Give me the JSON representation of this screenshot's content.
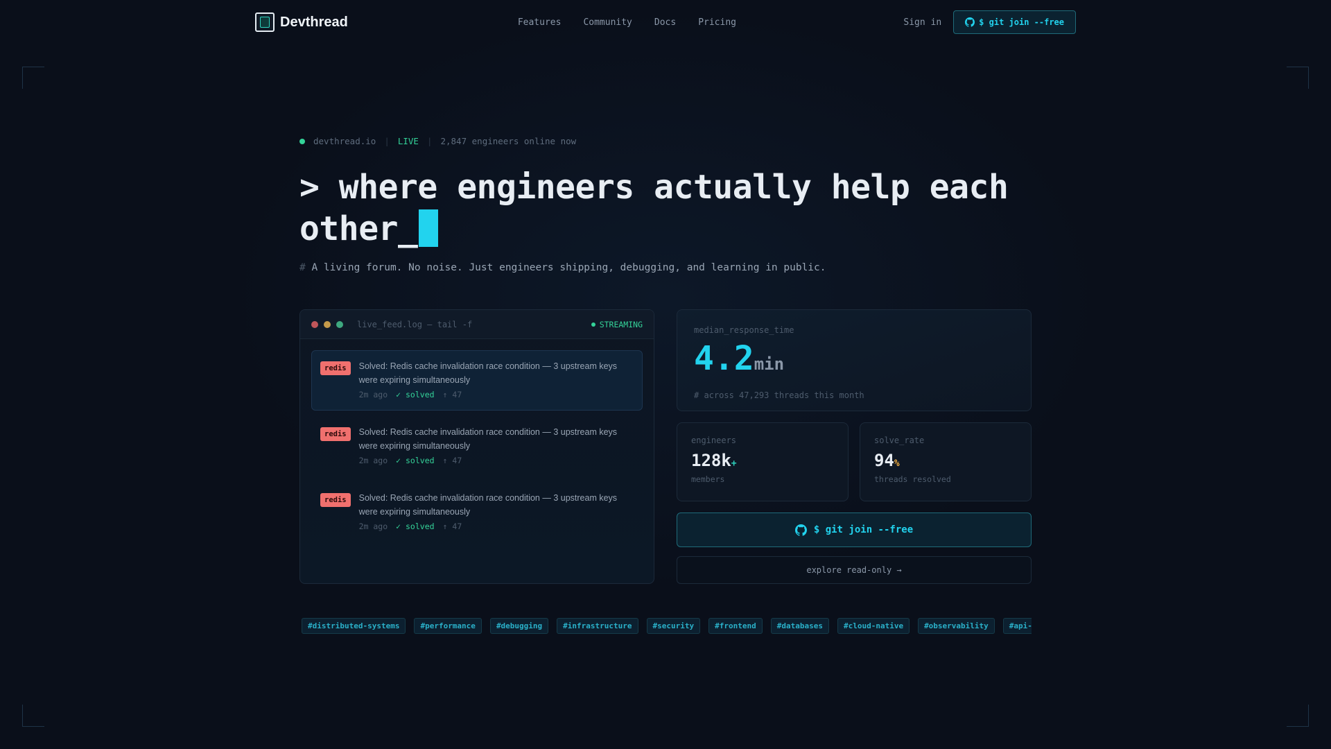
{
  "nav": {
    "brand": "Devthread",
    "links": [
      "Features",
      "Community",
      "Docs",
      "Pricing"
    ],
    "signin": "Sign in",
    "cta": "$ git join --free"
  },
  "hero": {
    "domain": "devthread.io",
    "live": "LIVE",
    "online": "2,847 engineers online now",
    "headline": "> where engineers actually help each other_",
    "sub_hash": "#",
    "subline": "A living forum. No noise. Just engineers shipping, debugging, and learning in public."
  },
  "terminal": {
    "title": "live_feed.log — tail -f",
    "status": "STREAMING",
    "items": [
      {
        "tag": "redis",
        "title": "Solved: Redis cache invalidation race condition — 3 upstream keys were expiring simultaneously",
        "time": "2m ago",
        "solved": "✓ solved",
        "votes": "↑ 47"
      },
      {
        "tag": "redis",
        "title": "Solved: Redis cache invalidation race condition — 3 upstream keys were expiring simultaneously",
        "time": "2m ago",
        "solved": "✓ solved",
        "votes": "↑ 47"
      },
      {
        "tag": "redis",
        "title": "Solved: Redis cache invalidation race condition — 3 upstream keys were expiring simultaneously",
        "time": "2m ago",
        "solved": "✓ solved",
        "votes": "↑ 47"
      }
    ]
  },
  "stats": {
    "main": {
      "label": "median_response_time",
      "value": "4.2",
      "unit": "min",
      "note": "# across 47,293 threads this month"
    },
    "engineers": {
      "label": "engineers",
      "value": "128k",
      "suffix": "+",
      "caption": "members"
    },
    "solve": {
      "label": "solve_rate",
      "value": "94",
      "suffix": "%",
      "caption": "threads resolved"
    }
  },
  "cta": {
    "join": "$ git join --free",
    "explore": "explore read-only →"
  },
  "tags": [
    "#distributed-systems",
    "#performance",
    "#debugging",
    "#infrastructure",
    "#security",
    "#frontend",
    "#databases",
    "#cloud-native",
    "#observability",
    "#api-design"
  ],
  "colors": {
    "accent": "#22d3ee",
    "green": "#34d399",
    "redis": "#f0706e",
    "bg": "#0a0f1a"
  },
  "icons": {
    "logo": "brand-logo-icon",
    "github": "github-icon"
  }
}
